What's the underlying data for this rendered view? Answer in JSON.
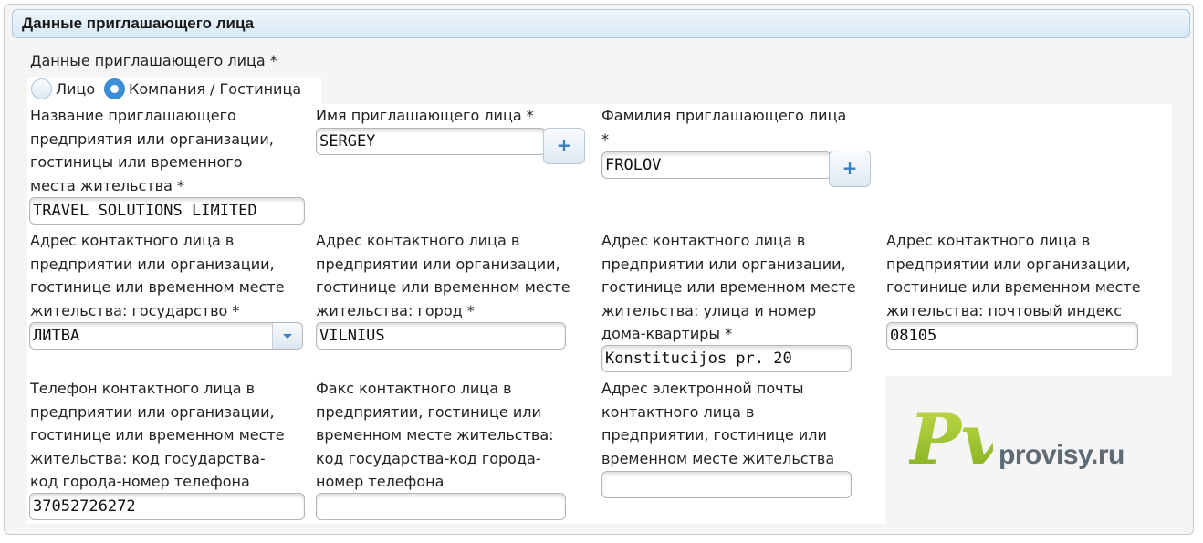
{
  "section": {
    "title": "Данные приглашающего лица"
  },
  "inviter_type": {
    "label": "Данные приглашающего лица *",
    "options": [
      {
        "label": "Лицо",
        "selected": false
      },
      {
        "label": "Компания / Гостиница",
        "selected": true
      }
    ]
  },
  "fields": {
    "org_name": {
      "label": "Название приглашающего\nпредприятия или организации,\nгостиницы или временного\nместа жительства *",
      "value": "TRAVEL SOLUTIONS LIMITED"
    },
    "first_name": {
      "label": "Имя приглашающего лица *",
      "value": "SERGEY",
      "add_label": "+"
    },
    "last_name": {
      "label": "Фамилия приглашающего лица\n*",
      "value": "FROLOV",
      "add_label": "+"
    },
    "country": {
      "label": "Адрес контактного лица в\nпредприятии или организации,\nгостинице или временном месте\nжительства: государство *",
      "value": "ЛИТВА"
    },
    "city": {
      "label": "Адрес контактного лица в\nпредприятии или организации,\nгостинице или временном месте\nжительства: город *",
      "value": "VILNIUS"
    },
    "street": {
      "label": "Адрес контактного лица в\nпредприятии или организации,\nгостинице или временном месте\nжительства: улица и номер\nдома-квартиры *",
      "value": "Konstitucijos pr. 20"
    },
    "postal_code": {
      "label": "Адрес контактного лица в\nпредприятии или организации,\nгостинице или временном месте\nжительства: почтовый индекс",
      "value": "08105"
    },
    "phone": {
      "label": "Телефон контактного лица в\nпредприятии или организации,\nгостинице или временном месте\nжительства: код государства-\nкод города-номер телефона",
      "value": "37052726272"
    },
    "fax": {
      "label": "Факс контактного лица в\nпредприятии, гостинице или\nвременном месте жительства:\nкод государства-код города-\nномер телефона",
      "value": ""
    },
    "email": {
      "label": "Адрес электронной почты\nконтактного лица в\nпредприятии, гостинице или\nвременном месте жительства",
      "value": ""
    }
  },
  "watermark": {
    "mark": "Pv",
    "text": "provisy.ru"
  },
  "colors": {
    "accent": "#3b8fd6",
    "header_border": "#aac8e2",
    "logo_green": "#9ac12a",
    "logo_gray": "#5e6b74"
  }
}
